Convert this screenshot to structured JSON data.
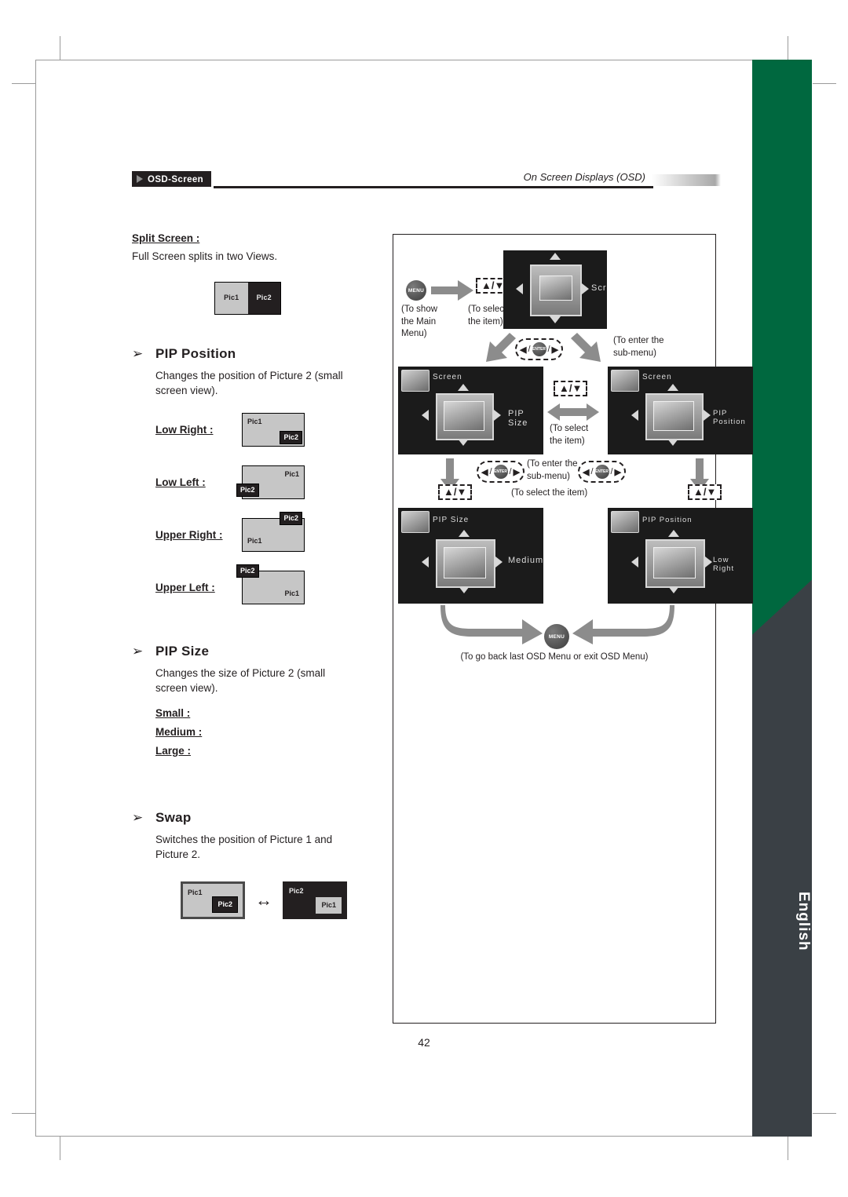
{
  "header": {
    "badge": "OSD-Screen",
    "right_title": "On Screen Displays (OSD)"
  },
  "sidebar": {
    "language_label": "English",
    "green_color": "#00683f",
    "dark_color": "#3a4045"
  },
  "left_column": {
    "split_screen": {
      "label": "Split Screen :",
      "description": "Full Screen splits in two Views.",
      "diagram": {
        "left_tag": "Pic1",
        "right_tag": "Pic2"
      }
    },
    "pip_position": {
      "heading": "PIP Position",
      "bullet": "➢",
      "description": "Changes the position of Picture 2 (small screen view).",
      "options": [
        {
          "label": "Low Right :",
          "main_tag": "Pic1",
          "sub_tag": "Pic2",
          "sub_corner": "bottom-right",
          "main_corner": "top-left"
        },
        {
          "label": "Low Left :",
          "main_tag": "Pic1",
          "sub_tag": "Pic2",
          "sub_corner": "bottom-left",
          "main_corner": "top-right"
        },
        {
          "label": "Upper Right :",
          "main_tag": "Pic1",
          "sub_tag": "Pic2",
          "sub_corner": "top-right",
          "main_corner": "bottom-left"
        },
        {
          "label": "Upper Left :",
          "main_tag": "Pic1",
          "sub_tag": "Pic2",
          "sub_corner": "top-left",
          "main_corner": "bottom-right"
        }
      ]
    },
    "pip_size": {
      "heading": "PIP Size",
      "bullet": "➢",
      "description": "Changes the size of Picture 2 (small screen view).",
      "options": [
        "Small :",
        "Medium :",
        "Large :"
      ]
    },
    "swap": {
      "heading": "Swap",
      "bullet": "➢",
      "description": "Switches the position of Picture 1 and Picture 2.",
      "left_diagram": {
        "main_tag": "Pic1",
        "sub_tag": "Pic2"
      },
      "right_diagram": {
        "main_tag": "Pic2",
        "sub_tag": "Pic1"
      },
      "arrow": "↔"
    }
  },
  "panel": {
    "menu_button_label": "MENU",
    "enter_button_label": "ENTER",
    "updown_label": "▲/▼",
    "leftright_left": "◀",
    "leftright_right": "▶",
    "slash": "/",
    "captions": {
      "show_main_menu": "(To show\nthe Main\nMenu)",
      "select_item_1": "(To select\nthe item)",
      "enter_submenu_1": "(To enter the\nsub-menu)",
      "select_item_2": "(To select\nthe item)",
      "enter_submenu_2": "(To enter the\nsub-menu)",
      "select_item_3": "(To select the item)",
      "footer": "(To go back last OSD Menu or exit OSD Menu)"
    },
    "screens": {
      "main": {
        "title": "Screen",
        "value": ""
      },
      "pip_size_menu": {
        "title": "Screen",
        "value": "PIP Size"
      },
      "pip_position_menu": {
        "title": "Screen",
        "value": "PIP Position"
      },
      "pip_size_sub": {
        "title": "PIP Size",
        "value": "Medium"
      },
      "pip_position_sub": {
        "title": "PIP Position",
        "value": "Low Right"
      }
    }
  },
  "page_number": "42"
}
